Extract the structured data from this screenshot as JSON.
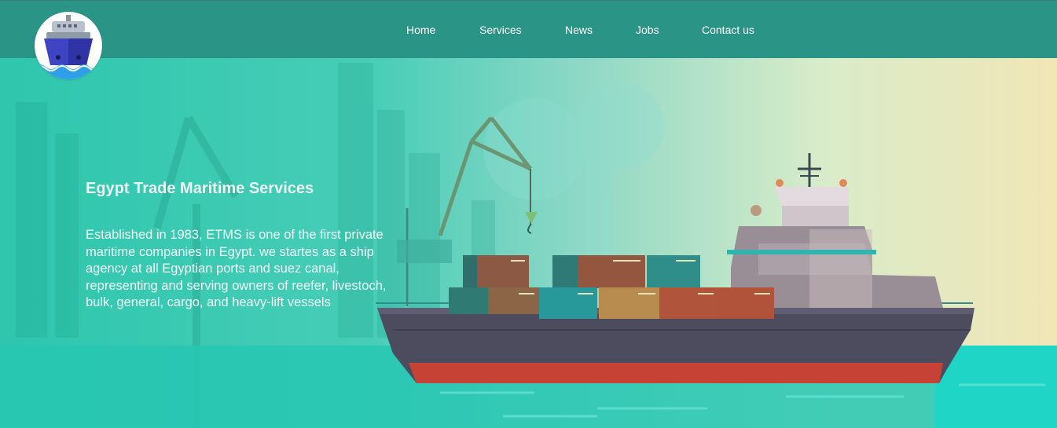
{
  "nav": {
    "logo_icon": "ship-logo-icon",
    "items": [
      {
        "label": "Home"
      },
      {
        "label": "Services"
      },
      {
        "label": "News"
      },
      {
        "label": "Jobs"
      },
      {
        "label": "Contact us"
      }
    ]
  },
  "hero": {
    "title": "Egypt Trade Maritime Services",
    "description": "Established in 1983, ETMS is one of the first private maritime companies in Egypt. we startes as a ship agency at all Egyptian ports and suez canal, representing and serving owners of reefer, livestoch, bulk, general, cargo, and heavy-lift vessels",
    "illustration": "cargo-ship-port-illustration"
  },
  "colors": {
    "navbar": "#2a9486",
    "hero_teal": "#2ec6ad",
    "hero_sand": "#f1e6b6",
    "text": "#ffffff"
  }
}
